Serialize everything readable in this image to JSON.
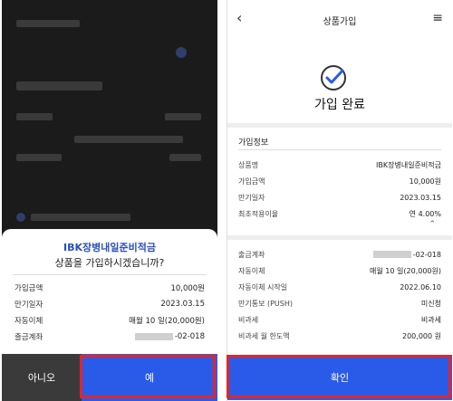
{
  "left": {
    "modal": {
      "title": "IBK장병내일준비적금",
      "question": "상품을 가입하시겠습니까?",
      "rows": [
        {
          "label": "가입금액",
          "value": "10,000원"
        },
        {
          "label": "만기일자",
          "value": "2023.03.15"
        },
        {
          "label": "자동이체",
          "value": "매월 10 일(20,000원)"
        },
        {
          "label": "출금계좌",
          "value": "-02-018"
        }
      ]
    },
    "buttons": {
      "no": "아니오",
      "yes": "예"
    }
  },
  "right": {
    "header_title": "상품가입",
    "complete_text": "가입 완료",
    "section_title": "가입정보",
    "group1": [
      {
        "label": "상품명",
        "value": "IBK장병내일준비적금"
      },
      {
        "label": "가입금액",
        "value": "10,000원"
      },
      {
        "label": "만기일자",
        "value": "2023.03.15"
      },
      {
        "label": "최초적용이율",
        "value": "연 4.00%"
      }
    ],
    "group2": [
      {
        "label": "출금계좌",
        "value": "-02-018"
      },
      {
        "label": "자동이체",
        "value": "매월 10 일(20,000원)"
      },
      {
        "label": "자동이체 시작일",
        "value": "2022.06.10"
      },
      {
        "label": "만기통보 (PUSH)",
        "value": "미신청"
      },
      {
        "label": "비과세",
        "value": "비과세"
      },
      {
        "label": "비과세 월 한도액",
        "value": "200,000 원"
      }
    ],
    "confirm": "확인"
  },
  "colors": {
    "accent": "#2a5be8",
    "highlight": "#e0262b"
  }
}
